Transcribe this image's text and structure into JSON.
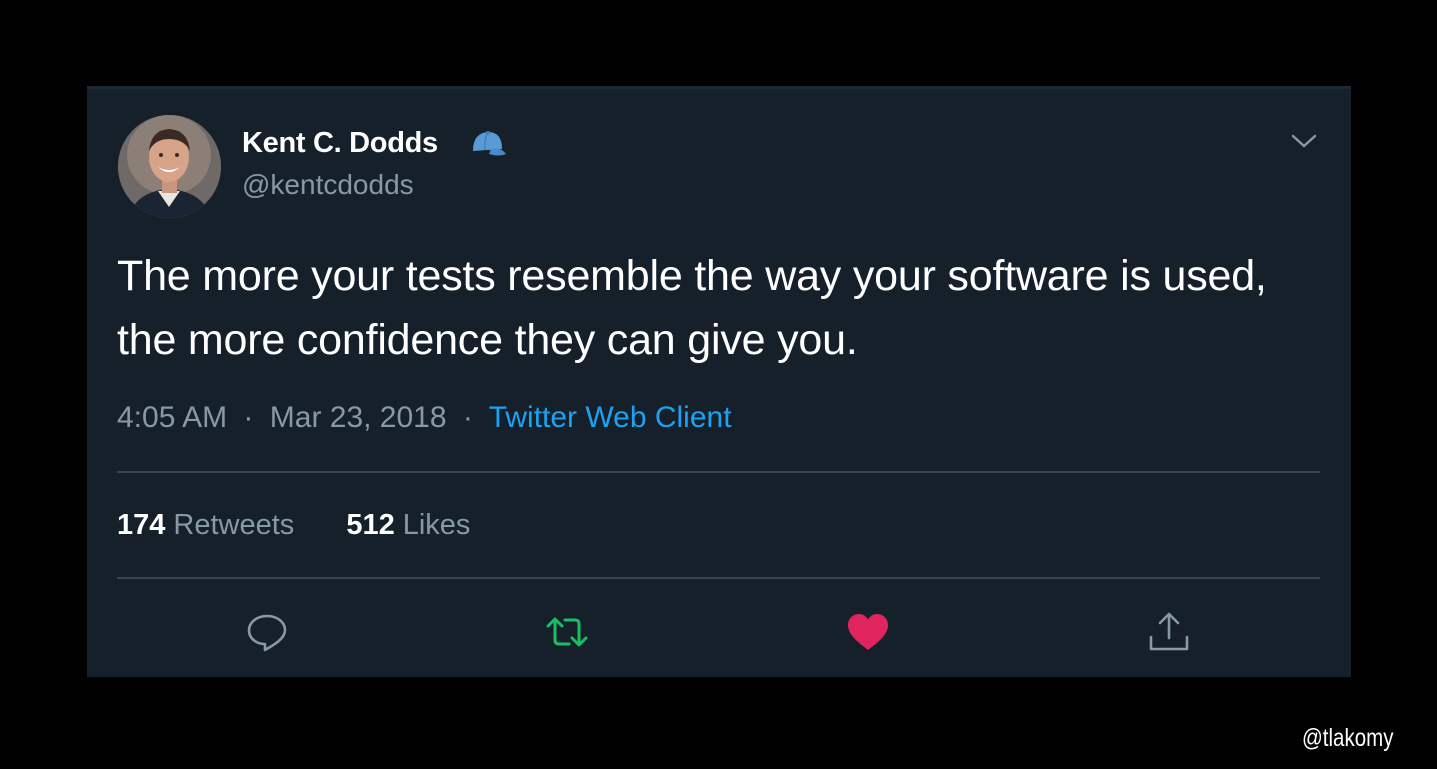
{
  "tweet": {
    "author_name": "Kent C. Dodds",
    "author_handle": "@kentcdodds",
    "text": "The more your tests resemble the way your software is used, the more confidence they can give you.",
    "time": "4:05 AM",
    "separator": "·",
    "date": "Mar 23, 2018",
    "client": "Twitter Web Client",
    "retweets_count": "174",
    "retweets_label": "Retweets",
    "likes_count": "512",
    "likes_label": "Likes",
    "badge_icon": "baseball-cap-icon",
    "menu_icon": "chevron-down-icon",
    "action_icons": [
      "reply-icon",
      "retweet-icon",
      "like-icon",
      "share-icon"
    ],
    "liked": true,
    "retweeted": true
  },
  "watermark": "@tlakomy",
  "colors": {
    "page_background": "#000000",
    "card_background": "#15202b",
    "primary_text": "#ffffff",
    "secondary_text": "#8899a6",
    "link": "#1da1f2",
    "divider": "#38444d",
    "retweet_active": "#17bf63",
    "like_active": "#e0245e",
    "badge": "#5b9bd5"
  }
}
